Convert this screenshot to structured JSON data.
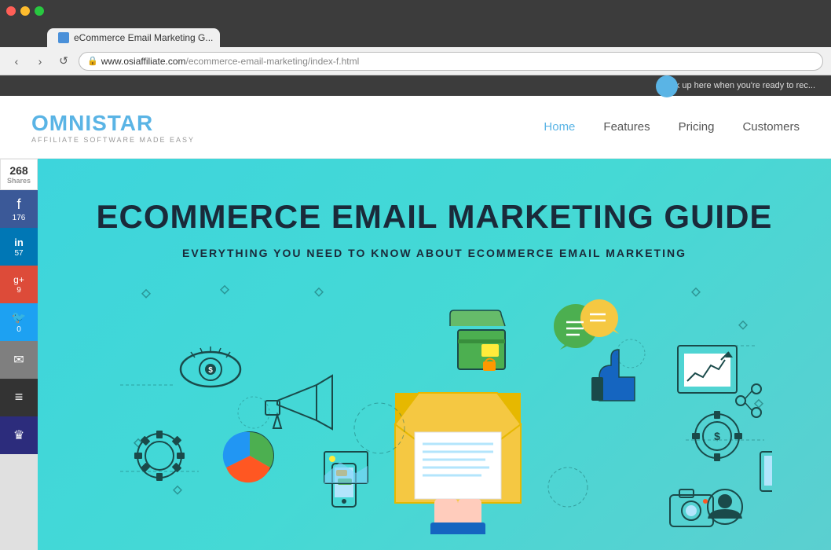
{
  "browser": {
    "dots": [
      "red",
      "yellow",
      "green"
    ],
    "tab_title": "eCommerce Email Marketing G...",
    "tab_close": "×",
    "tab_inactive": "",
    "nav_back": "‹",
    "nav_forward": "›",
    "nav_refresh": "↺",
    "address_secure": "🔒",
    "address_main": "www.osiaffiliate.com",
    "address_path": "/ecommerce-email-marketing/index-f.html",
    "banner_text": "Click up here when you're ready to rec..."
  },
  "header": {
    "logo_omni": "OMNI",
    "logo_star": "STAR",
    "logo_tagline": "AFFILIATE SOFTWARE MADE EASY",
    "nav": [
      {
        "label": "Home",
        "active": true
      },
      {
        "label": "Features",
        "active": false
      },
      {
        "label": "Pricing",
        "active": false
      },
      {
        "label": "Customers",
        "active": false
      }
    ]
  },
  "share_sidebar": {
    "count": "268",
    "shares_label": "Shares",
    "facebook_count": "176",
    "linkedin_count": "57",
    "googleplus_count": "9",
    "twitter_count": "0",
    "facebook_icon": "f",
    "linkedin_icon": "in",
    "googleplus_icon": "g+",
    "twitter_icon": "🐦",
    "email_icon": "✉",
    "buffer_icon": "≡",
    "crown_icon": "♛"
  },
  "hero": {
    "title": "ECOMMERCE EMAIL MARKETING GUIDE",
    "subtitle": "EVERYTHING YOU NEED TO KNOW ABOUT ECOMMERCE EMAIL MARKETING"
  }
}
